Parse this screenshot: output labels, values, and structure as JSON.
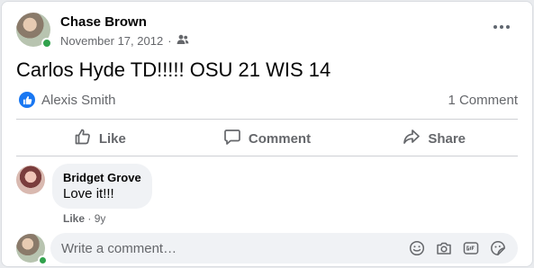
{
  "post": {
    "author": "Chase Brown",
    "date": "November 17, 2012",
    "separator": "·",
    "audience_icon": "friends-icon",
    "text": "Carlos Hyde TD!!!!! OSU 21 WIS 14"
  },
  "reactions": {
    "reactor": "Alexis Smith",
    "comment_count": "1 Comment"
  },
  "actions": {
    "like_label": "Like",
    "comment_label": "Comment",
    "share_label": "Share"
  },
  "comments": [
    {
      "author": "Bridget Grove",
      "text": "Love it!!!",
      "like_label": "Like",
      "separator": "·",
      "time": "9y"
    }
  ],
  "composer": {
    "placeholder": "Write a comment…",
    "icons": [
      "emoji-icon",
      "camera-icon",
      "gif-icon",
      "sticker-icon"
    ]
  },
  "colors": {
    "accent": "#1877f2",
    "online": "#31a24c",
    "secondary_text": "#65676b"
  }
}
